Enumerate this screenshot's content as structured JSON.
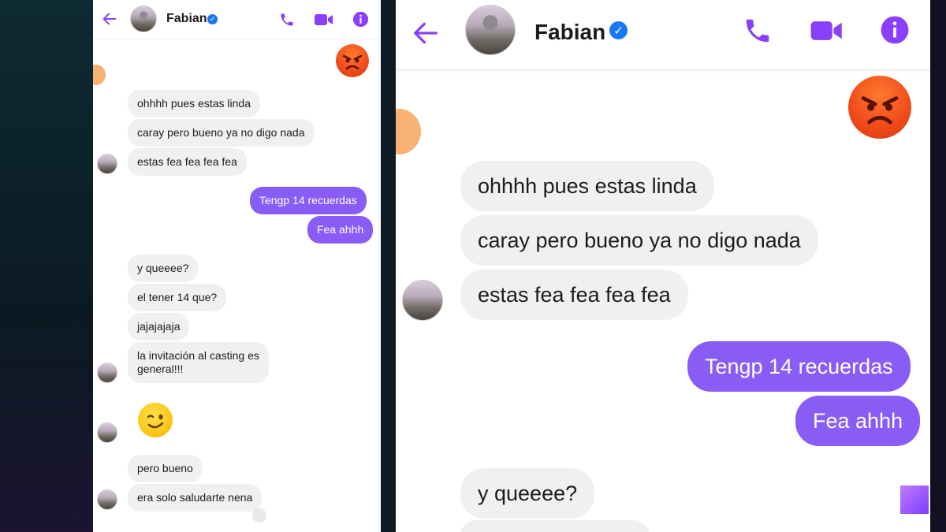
{
  "contact": {
    "name": "Fabian"
  },
  "colors": {
    "accent": "#8a5cf6",
    "icon": "#8a3ffc",
    "verified": "#1877f2",
    "incoming": "#f0f0f0"
  },
  "header_icons": [
    "back-arrow-icon",
    "phone-icon",
    "video-call-icon",
    "info-icon"
  ],
  "left_chat": {
    "messages": [
      {
        "text": "ohhhh pues estas linda",
        "dir": "in"
      },
      {
        "text": "caray pero bueno ya no digo nada",
        "dir": "in"
      },
      {
        "text": "estas fea fea fea fea",
        "dir": "in"
      },
      {
        "text": "Tengp 14 recuerdas",
        "dir": "out"
      },
      {
        "text": "Fea ahhh",
        "dir": "out"
      },
      {
        "text": "y queeee?",
        "dir": "in"
      },
      {
        "text": "el tener 14 que?",
        "dir": "in"
      },
      {
        "text": "jajajajaja",
        "dir": "in"
      },
      {
        "text": "la invitación al casting es",
        "dir": "in"
      },
      {
        "text": "general!!!",
        "dir": "in"
      },
      {
        "text": "pero bueno",
        "dir": "in"
      },
      {
        "text": "era solo saludarte nena",
        "dir": "in"
      }
    ]
  },
  "right_chat": {
    "messages": [
      {
        "text": "ohhhh pues estas linda",
        "dir": "in"
      },
      {
        "text": "caray pero bueno ya no digo nada",
        "dir": "in"
      },
      {
        "text": "estas fea fea fea fea",
        "dir": "in"
      },
      {
        "text": "Tengp 14 recuerdas",
        "dir": "out"
      },
      {
        "text": "Fea ahhh",
        "dir": "out"
      },
      {
        "text": "y queeee?",
        "dir": "in"
      }
    ]
  }
}
